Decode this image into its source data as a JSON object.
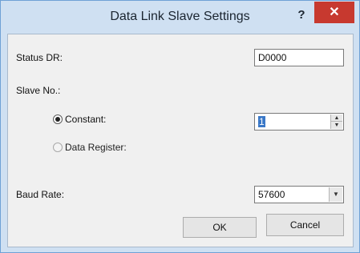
{
  "window": {
    "title": "Data Link Slave Settings",
    "help_label": "?",
    "close_label": "✕"
  },
  "status_dr": {
    "label": "Status DR:",
    "value": "D0000"
  },
  "slave_no": {
    "label": "Slave No.:",
    "constant_label": "Constant:",
    "constant_selected": true,
    "data_register_label": "Data Register:",
    "data_register_enabled": false,
    "constant_value": "1",
    "spin_up": "▲",
    "spin_down": "▼"
  },
  "baud_rate": {
    "label": "Baud Rate:",
    "value": "57600",
    "dropdown_arrow": "▼"
  },
  "buttons": {
    "ok": "OK",
    "cancel": "Cancel"
  }
}
